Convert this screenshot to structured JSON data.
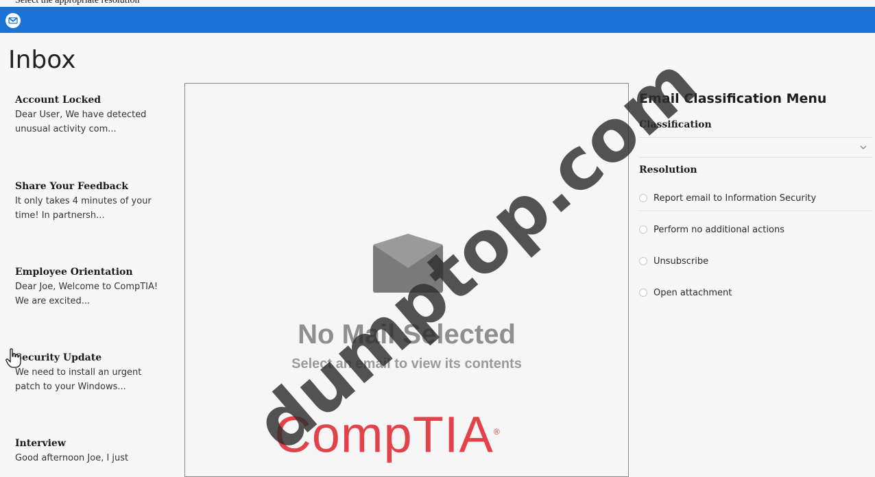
{
  "instruction": "Select the appropriate resolution",
  "app": {
    "icon": "mail-envelope-icon",
    "header_color": "#1a74d6"
  },
  "inbox": {
    "title": "Inbox",
    "emails": [
      {
        "subject": "Account Locked",
        "preview_line1": "Dear User, We have detected",
        "preview_line2": "unusual activity com..."
      },
      {
        "subject": "Share Your Feedback",
        "preview_line1": "It only takes 4 minutes of your",
        "preview_line2": "time! In partnersh..."
      },
      {
        "subject": "Employee Orientation",
        "preview_line1": "Dear Joe, Welcome to CompTIA!",
        "preview_line2": "We are excited..."
      },
      {
        "subject": "Security Update",
        "preview_line1": "We need to install an urgent",
        "preview_line2": "patch to your Windows..."
      },
      {
        "subject": "Interview",
        "preview_line1": "Good afternoon Joe, I just",
        "preview_line2": ""
      }
    ]
  },
  "viewer": {
    "empty_title": "No Mail Selected",
    "empty_subtitle": "Select an email to view its contents",
    "logo_text": "CompTIA",
    "logo_mark": "®",
    "logo_color": "#e3424a"
  },
  "classification_menu": {
    "title": "Email Classification Menu",
    "classification_label": "Classification",
    "classification_value": "",
    "resolution_label": "Resolution",
    "resolution_options": [
      "Report email to Information Security",
      "Perform no additional actions",
      "Unsubscribe",
      "Open attachment"
    ]
  },
  "watermark": "dumptop.com"
}
